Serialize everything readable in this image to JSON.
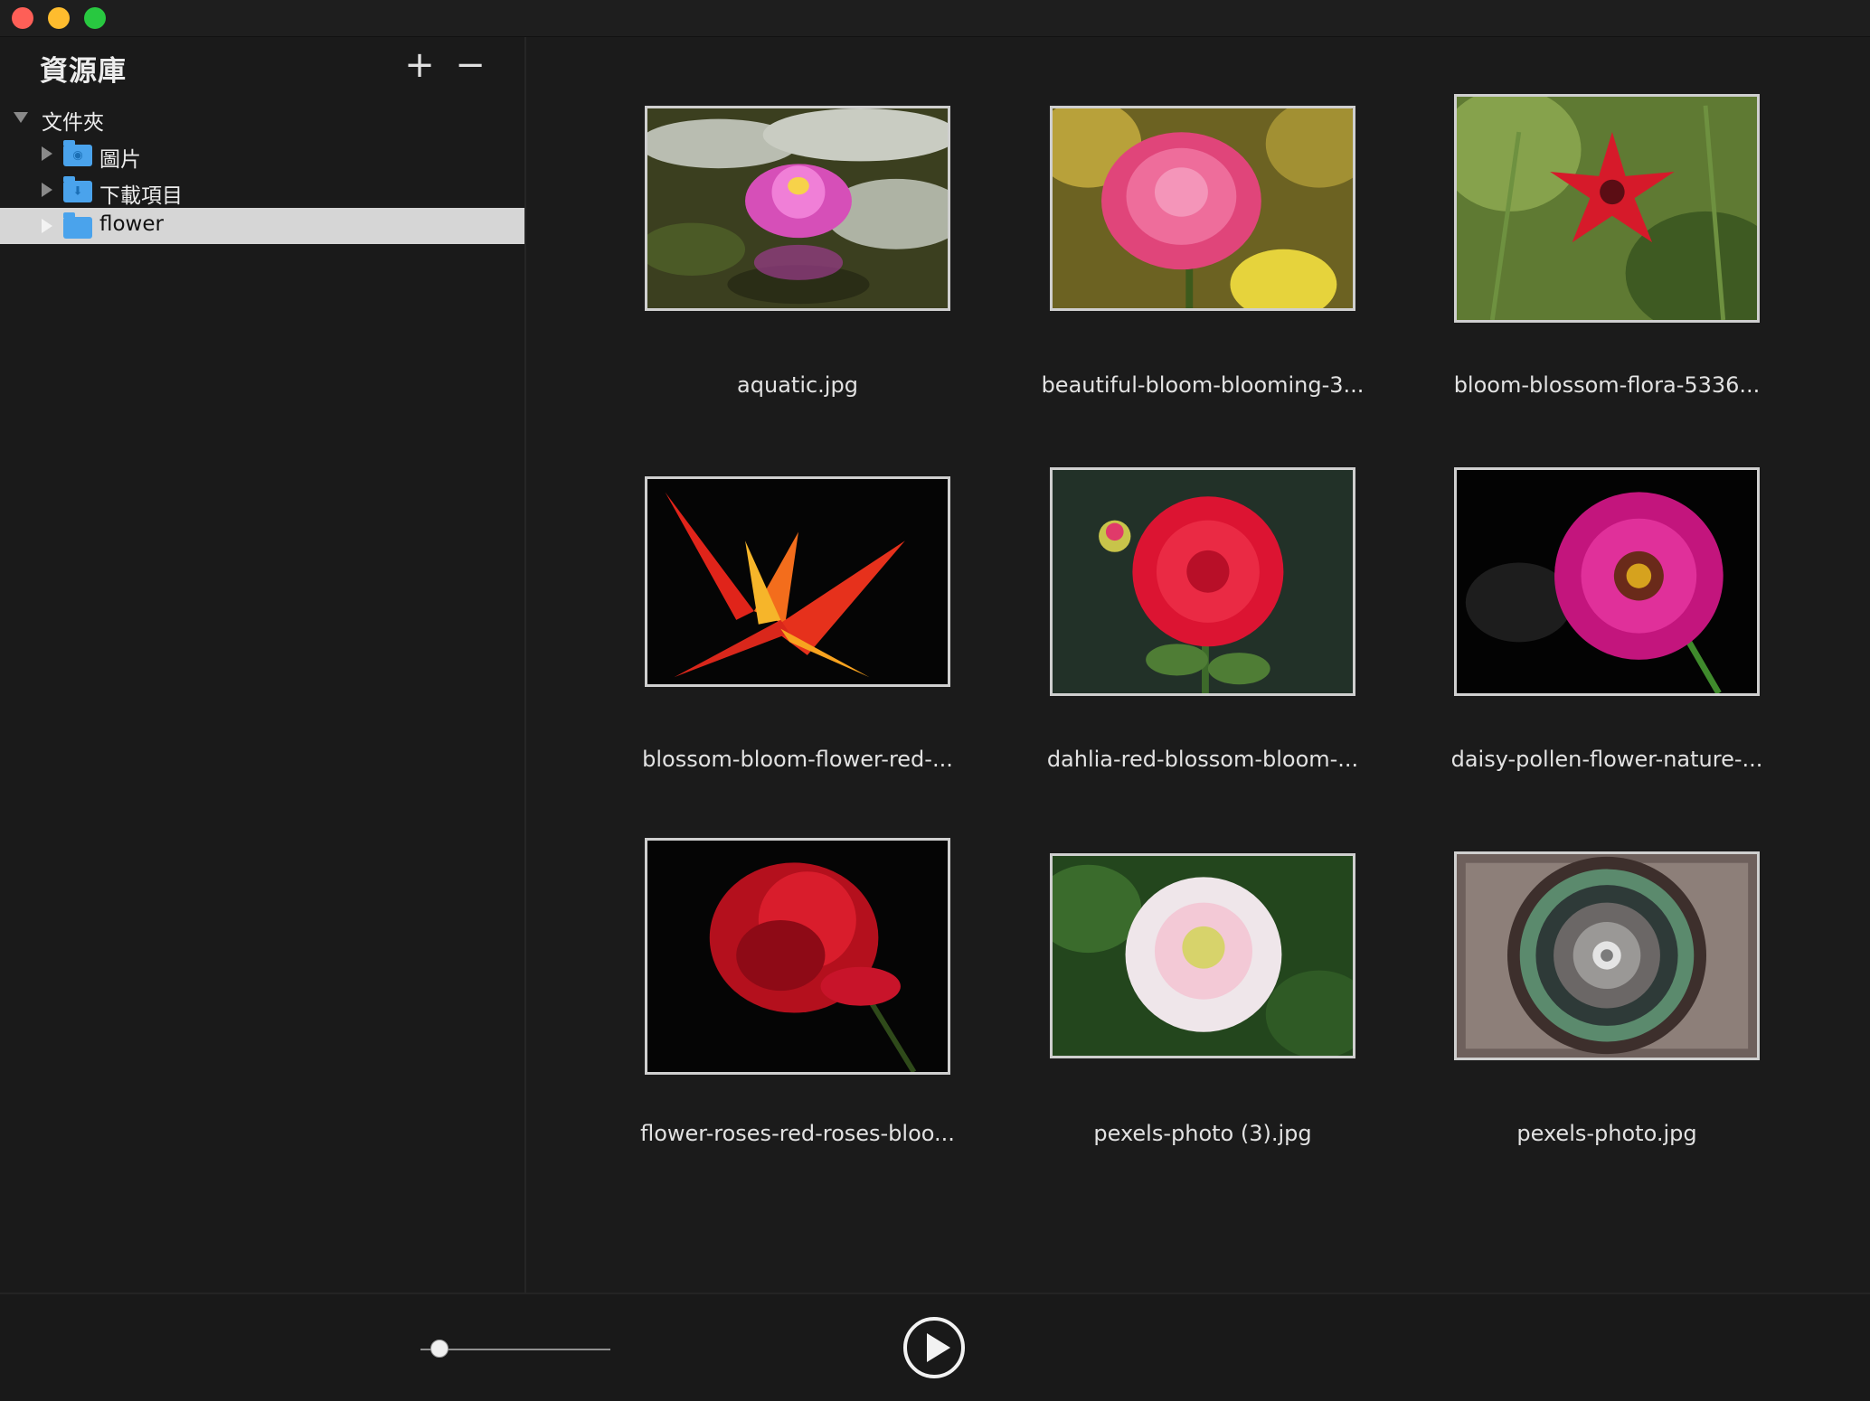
{
  "window": {
    "traffic_lights": {
      "close": "#fe5f57",
      "minimize": "#febc2e",
      "maximize": "#28c840"
    }
  },
  "sidebar": {
    "title": "資源庫",
    "add_label": "+",
    "remove_label": "−",
    "tree": [
      {
        "label": "文件夾",
        "expanded": true,
        "icon": "none"
      },
      {
        "label": "圖片",
        "expanded": false,
        "icon": "folder-camera-icon"
      },
      {
        "label": "下載項目",
        "expanded": false,
        "icon": "folder-download-icon"
      },
      {
        "label": "flower",
        "expanded": false,
        "icon": "folder-icon",
        "selected": true
      }
    ]
  },
  "gallery": {
    "items": [
      {
        "caption": "aquatic.jpg"
      },
      {
        "caption": "beautiful-bloom-blooming-3..."
      },
      {
        "caption": "bloom-blossom-flora-5336..."
      },
      {
        "caption": "blossom-bloom-flower-red-..."
      },
      {
        "caption": "dahlia-red-blossom-bloom-..."
      },
      {
        "caption": "daisy-pollen-flower-nature-..."
      },
      {
        "caption": "flower-roses-red-roses-bloo..."
      },
      {
        "caption": "pexels-photo (3).jpg"
      },
      {
        "caption": "pexels-photo.jpg"
      }
    ]
  },
  "bottom": {
    "zoom_slider_value": 0.1,
    "play_icon": "play-icon"
  }
}
